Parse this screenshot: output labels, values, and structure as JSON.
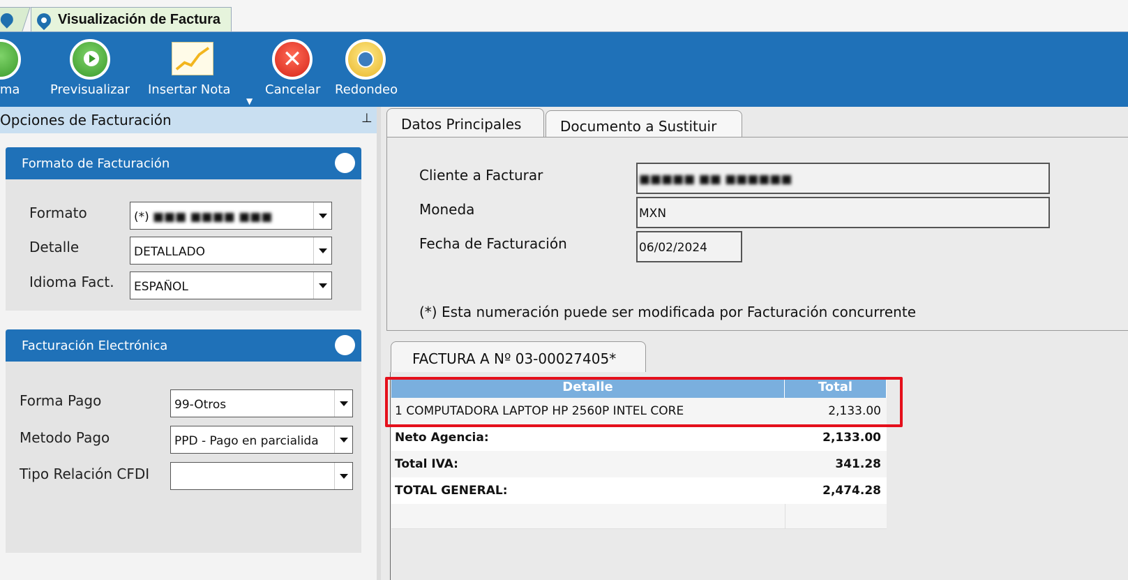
{
  "window": {
    "active_tab": "Visualización de Factura"
  },
  "toolbar": {
    "confirm_label": "nfirma",
    "preview_label": "Previsualizar",
    "insert_note_label": "Insertar Nota",
    "cancel_label": "Cancelar",
    "rounding_label": "Redondeo"
  },
  "left_panel": {
    "title": "Opciones de Facturación",
    "format_group": {
      "title": "Formato de Facturación",
      "format_label": "Formato",
      "format_value": "(*)",
      "detail_label": "Detalle",
      "detail_value": "DETALLADO",
      "language_label": "Idioma Fact.",
      "language_value": "ESPAÑOL"
    },
    "einvoice_group": {
      "title": "Facturación Electrónica",
      "payment_form_label": "Forma Pago",
      "payment_form_value": "99-Otros",
      "payment_method_label": "Metodo Pago",
      "payment_method_value": "PPD - Pago en parcialida",
      "relation_label": "Tipo Relación CFDI",
      "relation_value": ""
    }
  },
  "main": {
    "tabs": [
      {
        "label": "Datos Principales"
      },
      {
        "label": "Documento a Sustituir"
      }
    ],
    "client_label": "Cliente a Facturar",
    "currency_label": "Moneda",
    "currency_value": "MXN",
    "date_label": "Fecha de Facturación",
    "date_value": "06/02/2024",
    "note": "(*) Esta numeración puede ser modificada por Facturación concurrente"
  },
  "invoice": {
    "tab_label": "FACTURA A Nº 03-00027405*",
    "columns": {
      "detail": "Detalle",
      "total": "Total"
    },
    "items": [
      {
        "detail": "1 COMPUTADORA LAPTOP HP 2560P INTEL CORE",
        "total": "2,133.00"
      }
    ],
    "summary": [
      {
        "label": "Neto Agencia:",
        "value": "2,133.00"
      },
      {
        "label": "Total IVA:",
        "value": "341.28"
      },
      {
        "label": "TOTAL GENERAL:",
        "value": "2,474.28"
      }
    ]
  },
  "colors": {
    "toolbar": "#1f71b8",
    "header_grid": "#7aafde",
    "highlight": "#e5101c"
  }
}
